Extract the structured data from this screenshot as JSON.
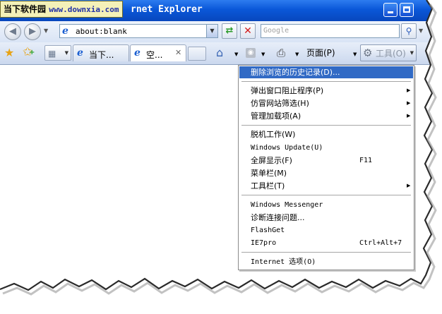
{
  "watermark": {
    "site": "当下软件园",
    "url": "www.downxia.com"
  },
  "window": {
    "title": "rnet Explorer"
  },
  "address": {
    "url": "about:blank",
    "search_placeholder": "Google"
  },
  "tabs": [
    {
      "label": "当下..."
    },
    {
      "label": "空..."
    }
  ],
  "toolbar": {
    "page_label": "页面(P)",
    "tools_label": "工具(O)"
  },
  "tools_menu": {
    "items": [
      {
        "label": "删除浏览的历史记录(D)...",
        "highlighted": true
      },
      {
        "label": "弹出窗口阻止程序(P)",
        "submenu": true
      },
      {
        "label": "仿冒网站筛选(H)",
        "submenu": true
      },
      {
        "label": "管理加载项(A)",
        "submenu": true
      },
      {
        "label": "脱机工作(W)"
      },
      {
        "label": "Windows Update(U)"
      },
      {
        "label": "全屏显示(F)",
        "shortcut": "F11"
      },
      {
        "label": "菜单栏(M)"
      },
      {
        "label": "工具栏(T)",
        "submenu": true
      },
      {
        "label": "Windows Messenger"
      },
      {
        "label": "诊断连接问题..."
      },
      {
        "label": "FlashGet"
      },
      {
        "label": "IE7pro",
        "shortcut": "Ctrl+Alt+7"
      },
      {
        "label": "Internet 选项(O)"
      }
    ]
  },
  "colors": {
    "titlebar": "#0a57d8",
    "menu_highlight": "#316ac5",
    "watermark_bg": "#f4f1b8"
  }
}
